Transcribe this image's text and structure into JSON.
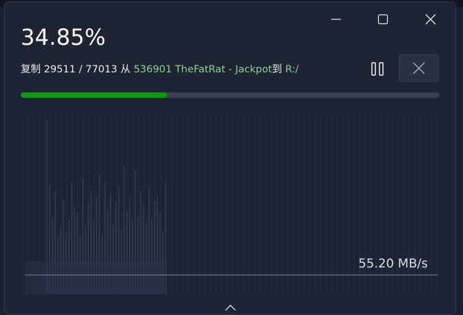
{
  "window": {
    "minimize_icon": "minimize-icon",
    "maximize_icon": "maximize-icon",
    "close_icon": "close-icon"
  },
  "progress": {
    "percent_text": "34.85%",
    "fraction": 0.3485,
    "fill_color": "#0e9a0e"
  },
  "info": {
    "prefix": "复制",
    "count": "29511 / 77013",
    "from_word": "从",
    "source": "536901 TheFatRat - Jackpot",
    "to_word": "到",
    "destination": "R:/",
    "highlight_color": "#86d28f"
  },
  "controls": {
    "pause_icon": "pause-icon",
    "cancel_icon": "close-icon"
  },
  "graph": {
    "speed_text": "55.20 MB/s"
  },
  "footer": {
    "expand_icon": "chevron-up-icon"
  }
}
